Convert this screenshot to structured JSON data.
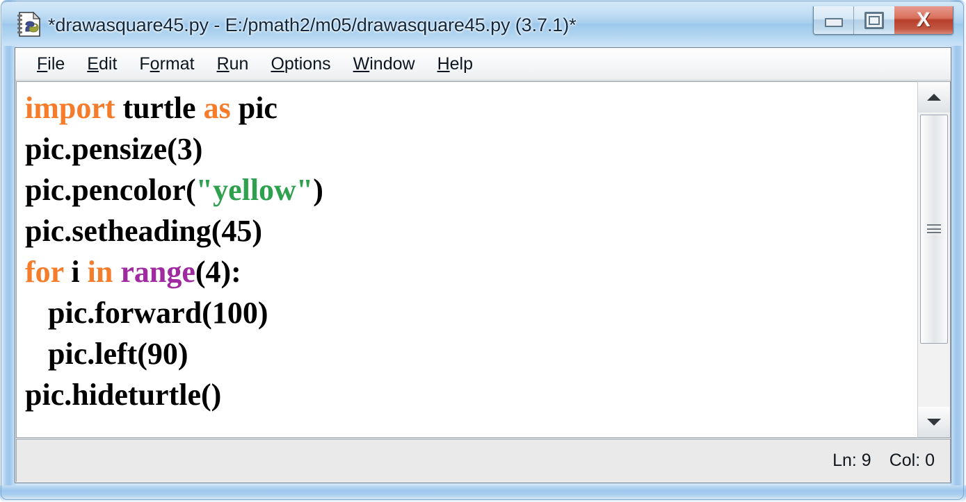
{
  "window": {
    "title": "*drawasquare45.py - E:/pmath2/m05/drawasquare45.py (3.7.1)*",
    "icon": "python-idle-file-icon",
    "controls": {
      "minimize": {
        "label": "Minimize",
        "icon": "minimize-icon"
      },
      "maximize": {
        "label": "Maximize",
        "icon": "maximize-icon"
      },
      "close": {
        "label": "Close",
        "icon": "close-icon",
        "glyph": "X",
        "color": "#b53f2b"
      }
    }
  },
  "menu": {
    "items": [
      {
        "label": "File",
        "accel": "F"
      },
      {
        "label": "Edit",
        "accel": "E"
      },
      {
        "label": "Format",
        "accel": "o"
      },
      {
        "label": "Run",
        "accel": "R"
      },
      {
        "label": "Options",
        "accel": "O"
      },
      {
        "label": "Window",
        "accel": "W"
      },
      {
        "label": "Help",
        "accel": "H"
      }
    ]
  },
  "editor": {
    "lines": [
      "import turtle as pic",
      "pic.pensize(3)",
      "pic.pencolor(\"yellow\")",
      "pic.setheading(45)",
      "for i in range(4):",
      "    pic.forward(100)",
      "    pic.left(90)",
      "pic.hideturtle()"
    ],
    "syntax_colors": {
      "keyword": "#f57c2a",
      "builtin": "#a02ba0",
      "string": "#2ea04e",
      "plain": "#000000"
    }
  },
  "scrollbar": {
    "up_arrow_icon": "triangle-up-icon",
    "down_arrow_icon": "triangle-down-icon",
    "grip_icon": "scrollbar-grip-icon"
  },
  "status": {
    "line_label": "Ln: 9",
    "column_label": "Col: 0"
  }
}
